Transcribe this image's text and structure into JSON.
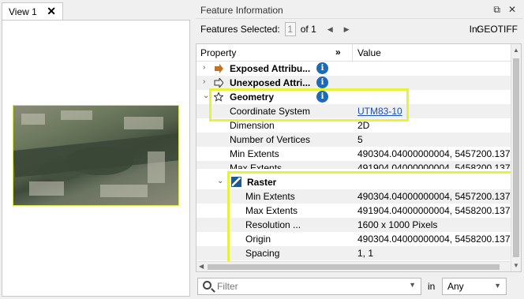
{
  "view": {
    "tab_label": "View 1",
    "close_glyph": "✕"
  },
  "feature_info": {
    "title": "Feature Information",
    "pin_glyph": "⧉",
    "close_glyph": "✕",
    "features_selected_label": "Features Selected:",
    "current_page": "1",
    "of_label": "of 1",
    "prev_glyph": "◀",
    "next_glyph": "▶",
    "in_label": "In:",
    "format": "GEOTIFF",
    "columns": {
      "property": "Property",
      "expand": "»",
      "value": "Value"
    },
    "rows": [
      {
        "label": "Exposed Attribu...",
        "value": "",
        "expander": "›",
        "info": "i"
      },
      {
        "label": "Unexposed Attri...",
        "value": "",
        "expander": "›",
        "info": "i"
      },
      {
        "label": "Geometry",
        "value": "",
        "expander": "⌄",
        "info": "i"
      },
      {
        "label": "Coordinate System",
        "value": "UTM83-10"
      },
      {
        "label": "Dimension",
        "value": "2D"
      },
      {
        "label": "Number of Vertices",
        "value": "5"
      },
      {
        "label": "Min Extents",
        "value": "490304.04000000004, 5457200.137"
      },
      {
        "label": "Max Extents",
        "value": "491904.04000000004, 5458200.137"
      },
      {
        "label": "Raster",
        "value": "",
        "expander": "⌄"
      },
      {
        "label": "Min Extents",
        "value": "490304.04000000004, 5457200.137"
      },
      {
        "label": "Max Extents",
        "value": "491904.04000000004, 5458200.137"
      },
      {
        "label": "Resolution ...",
        "value": "1600 x 1000 Pixels"
      },
      {
        "label": "Origin",
        "value": "490304.04000000004, 5458200.137"
      },
      {
        "label": "Spacing",
        "value": "1, 1"
      }
    ],
    "filter": {
      "placeholder": "Filter",
      "in_label": "in",
      "scope": "Any"
    }
  },
  "colors": {
    "highlight": "#e7f33a",
    "info_icon": "#1c6bb8",
    "link": "#1a4fb8"
  }
}
